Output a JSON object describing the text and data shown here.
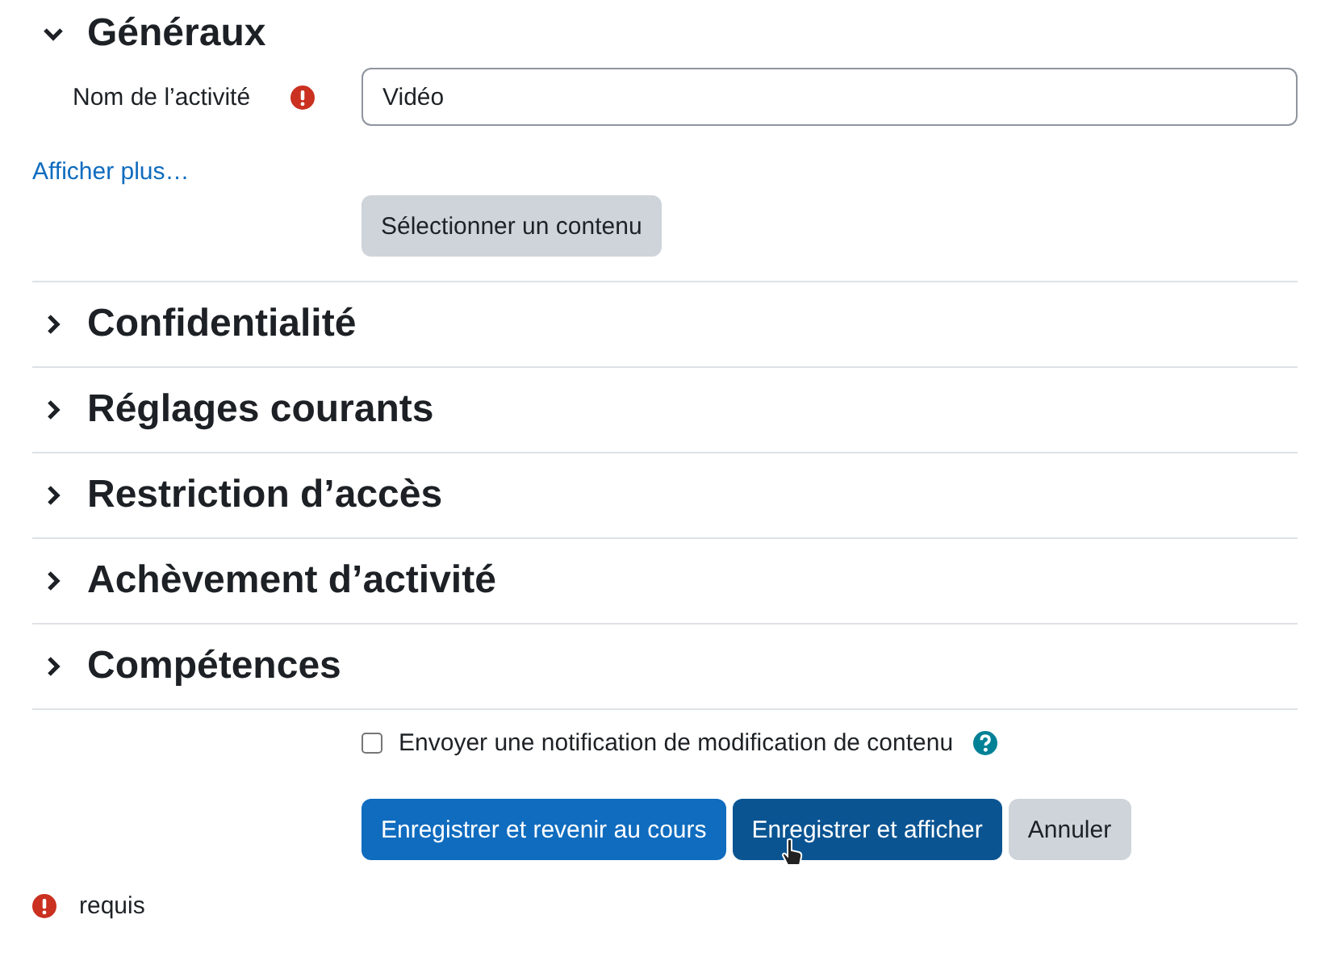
{
  "sections": [
    {
      "title": "Généraux",
      "expanded": true
    },
    {
      "title": "Confidentialité",
      "expanded": false
    },
    {
      "title": "Réglages courants",
      "expanded": false
    },
    {
      "title": "Restriction d’accès",
      "expanded": false
    },
    {
      "title": "Achèvement d’activité",
      "expanded": false
    },
    {
      "title": "Compétences",
      "expanded": false
    }
  ],
  "name_field": {
    "label": "Nom de l’activité",
    "required": true,
    "value": "Vidéo"
  },
  "show_more_link": "Afficher plus…",
  "select_content_button": "Sélectionner un contenu",
  "notify_checkbox": {
    "label": "Envoyer une notification de modification de contenu",
    "checked": false
  },
  "buttons": [
    {
      "label": "Enregistrer et revenir au cours",
      "kind": "primary",
      "hovered": false
    },
    {
      "label": "Enregistrer et afficher",
      "kind": "primary",
      "hovered": true
    },
    {
      "label": "Annuler",
      "kind": "secondary",
      "hovered": false
    }
  ],
  "required_note": "requis"
}
